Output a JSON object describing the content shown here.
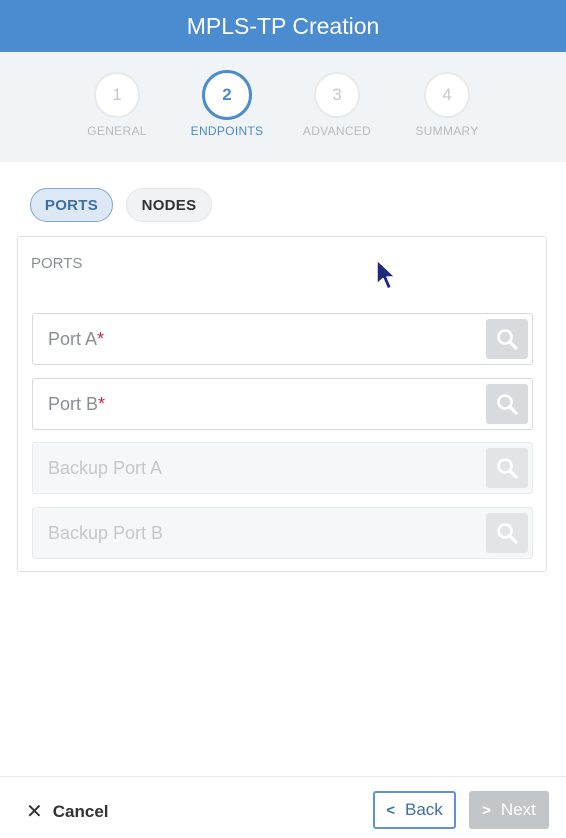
{
  "window": {
    "title": "MPLS-TP Creation"
  },
  "stepper": {
    "steps": [
      {
        "number": "1",
        "label": "GENERAL"
      },
      {
        "number": "2",
        "label": "ENDPOINTS"
      },
      {
        "number": "3",
        "label": "ADVANCED"
      },
      {
        "number": "4",
        "label": "SUMMARY"
      }
    ],
    "active_step": 2
  },
  "tabs": {
    "ports": "PORTS",
    "nodes": "NODES",
    "selected": "PORTS"
  },
  "panel": {
    "title": "PORTS",
    "fields": [
      {
        "label": "Port A",
        "required": "*",
        "enabled": true
      },
      {
        "label": "Port B",
        "required": "*",
        "enabled": true
      },
      {
        "label": "Backup Port A",
        "enabled": false
      },
      {
        "label": "Backup Port B",
        "enabled": false
      }
    ]
  },
  "footer": {
    "cancel_label": "Cancel",
    "back_label": "Back",
    "next_label": "Next",
    "next_enabled": false
  },
  "colors": {
    "accent": "#4b8bd0",
    "required": "#c8284e",
    "disabled_button": "#c3c6c9"
  },
  "icons": {
    "search": "search-icon",
    "close": "close-icon",
    "back": "chevron-left-icon",
    "next": "chevron-right-icon",
    "cursor": "mouse-pointer-icon"
  }
}
